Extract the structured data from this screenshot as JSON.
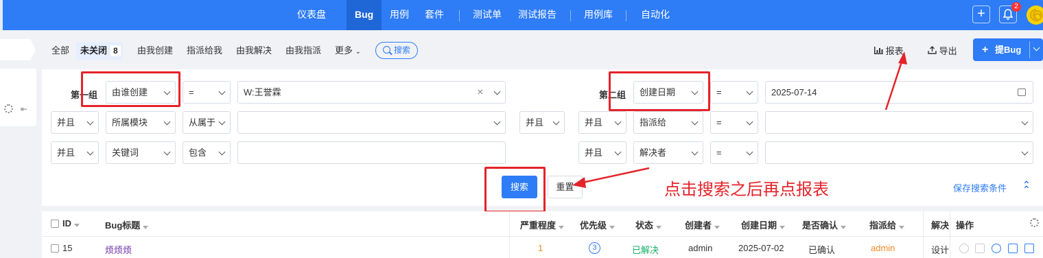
{
  "nav": {
    "items": [
      "仪表盘",
      "Bug",
      "用例",
      "套件",
      "测试单",
      "测试报告",
      "用例库",
      "自动化"
    ],
    "active": "Bug",
    "notification_count": "2",
    "add_icon": "plus-icon",
    "bell_icon": "bell-icon"
  },
  "toolbar": {
    "tabs": [
      "全部",
      "未关闭",
      "由我创建",
      "指派给我",
      "由我解决",
      "由我指派",
      "更多"
    ],
    "open_count": "8",
    "search_label": "搜索",
    "report_label": "报表",
    "export_label": "导出",
    "add_bug_label": "提Bug"
  },
  "search_form": {
    "group1_label": "第一组",
    "group2_label": "第二组",
    "rows_left": [
      {
        "connector": "",
        "field": "由谁创建",
        "op": "=",
        "value": "W:王誉霖"
      },
      {
        "connector": "并且",
        "field": "所属模块",
        "op": "从属于",
        "value": ""
      },
      {
        "connector": "并且",
        "field": "关键词",
        "op": "包含",
        "value": ""
      }
    ],
    "group_connector": "并且",
    "rows_right": [
      {
        "connector": "",
        "field": "创建日期",
        "op": "=",
        "value": "2025-07-14"
      },
      {
        "connector": "并且",
        "field": "指派给",
        "op": "=",
        "value": ""
      },
      {
        "connector": "并且",
        "field": "解决者",
        "op": "=",
        "value": ""
      }
    ],
    "search_button": "搜索",
    "reset_button": "重置",
    "save_link": "保存搜索条件"
  },
  "annotation": {
    "text": "点击搜索之后再点报表",
    "color": "#e4232a"
  },
  "table": {
    "headers": [
      "ID",
      "Bug标题",
      "严重程度",
      "优先级",
      "状态",
      "创建者",
      "创建日期",
      "是否确认",
      "指派给",
      "解决",
      "操作"
    ],
    "rows": [
      {
        "id": "15",
        "title": "烦烦烦",
        "severity": "1",
        "priority": "3",
        "status": "已解决",
        "creator": "admin",
        "created": "2025-07-02",
        "confirmed": "已确认",
        "assigned": "admin",
        "resolution": "设计"
      }
    ]
  },
  "colors": {
    "primary": "#2e7cf6",
    "resolved": "#17b26a",
    "assigned": "#f08a24",
    "title_link": "#6b2fa3",
    "severity": "#f08a24"
  }
}
